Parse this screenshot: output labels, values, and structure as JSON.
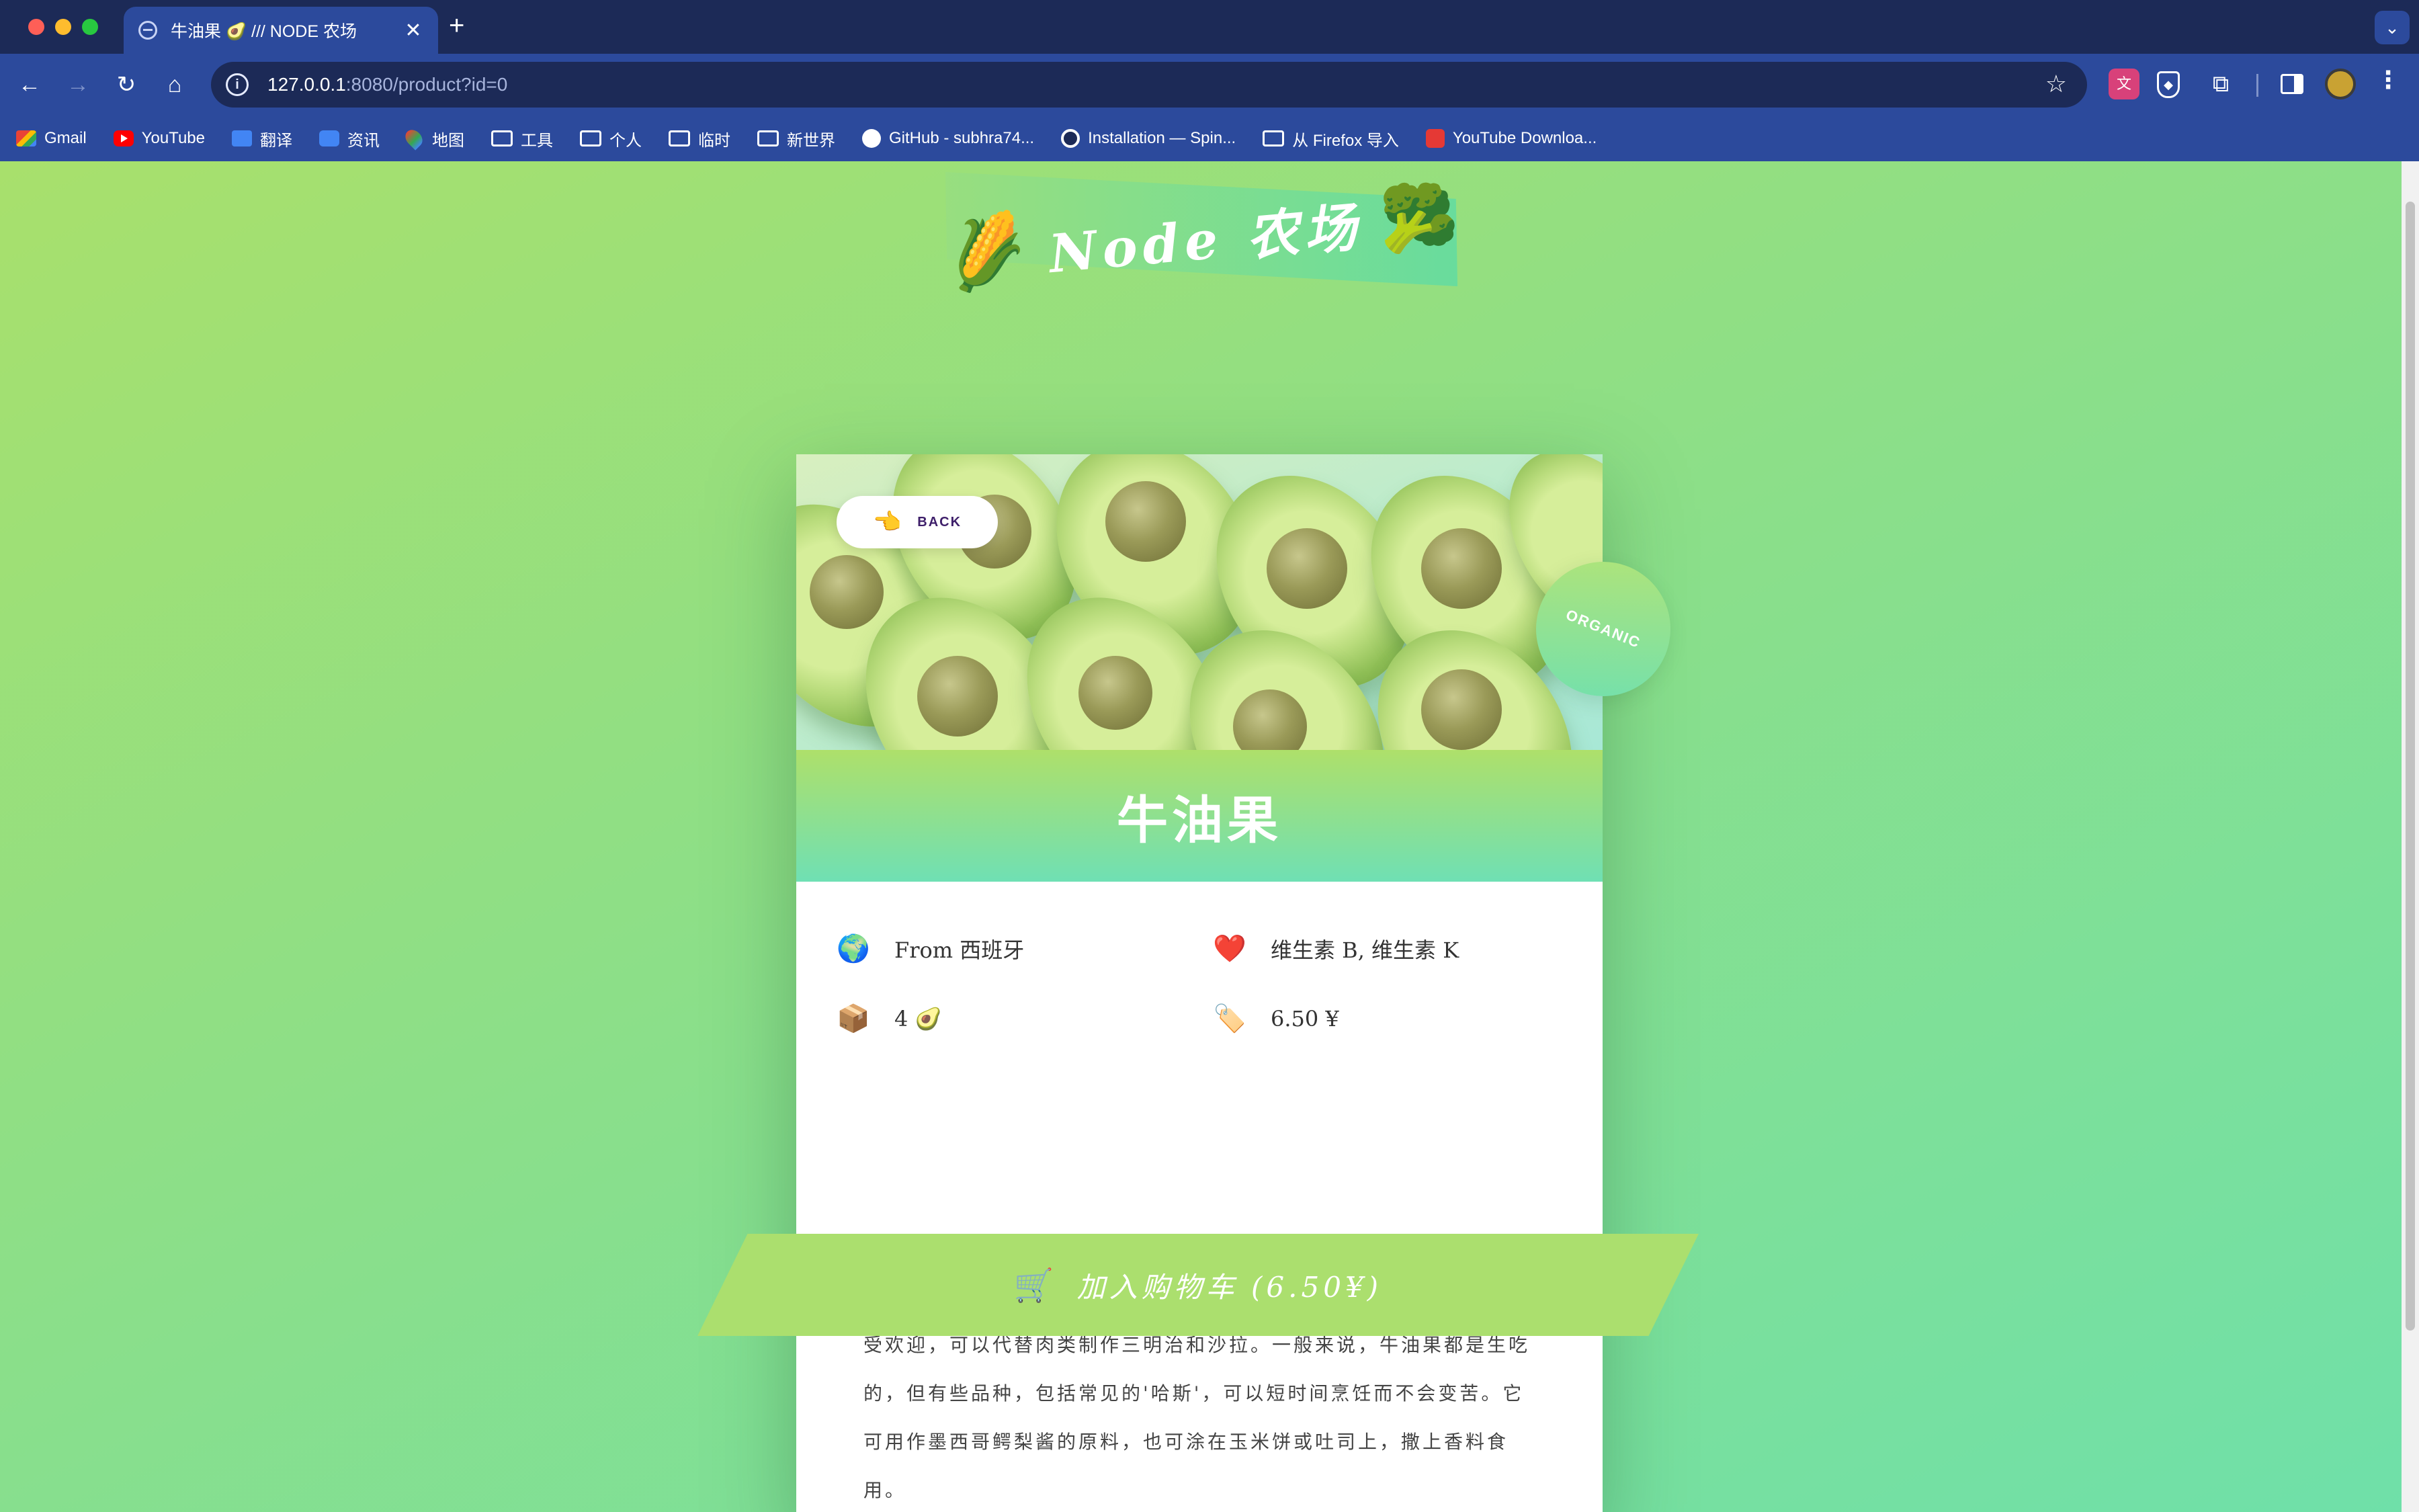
{
  "browser": {
    "tab_title": "牛油果 🥑 /// NODE 农场",
    "new_tab": "+",
    "url_host": "127.0.0.1",
    "url_rest": ":8080/product?id=0",
    "bookmarks": [
      {
        "label": "Gmail",
        "icon": "gmail-icon"
      },
      {
        "label": "YouTube",
        "icon": "youtube-icon"
      },
      {
        "label": "翻译",
        "icon": "translate-icon"
      },
      {
        "label": "资讯",
        "icon": "news-icon"
      },
      {
        "label": "地图",
        "icon": "maps-icon"
      },
      {
        "label": "工具",
        "icon": "folder-icon"
      },
      {
        "label": "个人",
        "icon": "folder-icon"
      },
      {
        "label": "临时",
        "icon": "folder-icon"
      },
      {
        "label": "新世界",
        "icon": "folder-icon"
      },
      {
        "label": "GitHub - subhra74...",
        "icon": "github-icon"
      },
      {
        "label": "Installation — Spin...",
        "icon": "spin-icon"
      },
      {
        "label": "从 Firefox 导入",
        "icon": "folder-icon"
      },
      {
        "label": "YouTube Downloa...",
        "icon": "download-icon"
      }
    ]
  },
  "page": {
    "logo_text": "Node 农场",
    "logo_left_emoji": "🌽",
    "logo_right_emoji": "🥦",
    "organic_badge": "ORGANIC",
    "back_label": "BACK",
    "back_emoji": "👈",
    "product_name": "牛油果",
    "from_emoji": "🌍",
    "from_text": "From 西班牙",
    "vitamins_emoji": "❤️",
    "vitamins_text": "维生素 B, 维生素 K",
    "quantity_emoji": "📦",
    "quantity_text": "4 🥑",
    "price_emoji": "🏷️",
    "price_text": "6.50 ¥",
    "cart_emoji": "🛒",
    "cart_label": "加入购物车 (6.50¥)",
    "description": "将成熟的牛油果放在手掌中轻轻挤压，它就会屈服。这种水果不甜，但味道独特而微妙，质地光滑。由于脂肪含量高，牛油果在素食菜肴中很受欢迎，可以代替肉类制作三明治和沙拉。一般来说，牛油果都是生吃的，但有些品种，包括常见的'哈斯'，可以短时间烹饪而不会变苦。它可用作墨西哥鳄梨酱的原料，也可涂在玉米饼或吐司上，撒上香料食用。"
  }
}
